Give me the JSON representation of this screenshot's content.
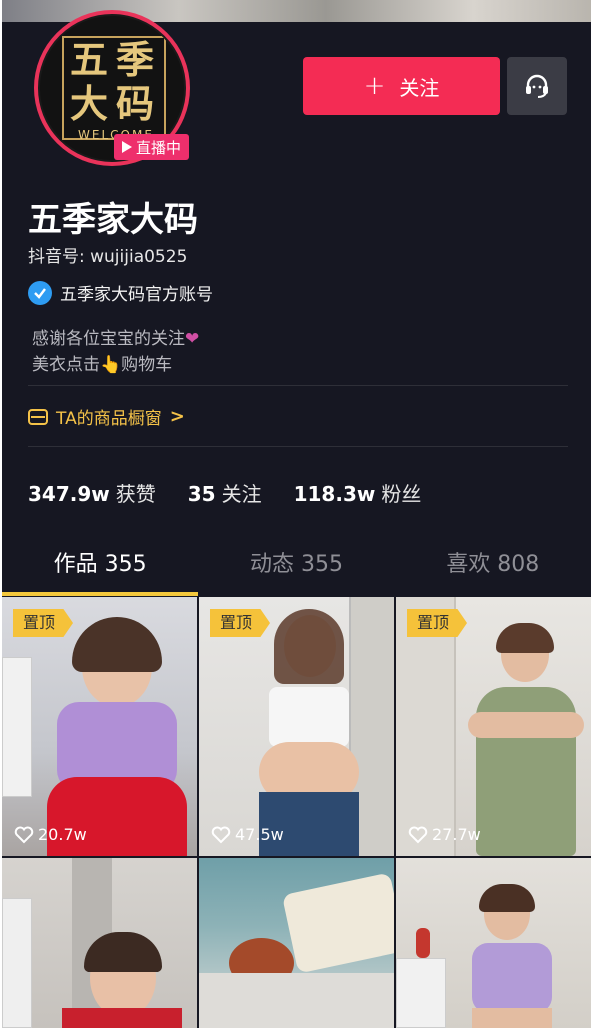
{
  "profile": {
    "avatar_logo": {
      "chars": [
        "五",
        "季",
        "大",
        "码"
      ],
      "welcome": "WELCOME"
    },
    "live_badge": "直播中",
    "follow_label": "关注",
    "follow_plus": "+",
    "name": "五季家大码",
    "douyin_id": "抖音号: wujijia0525",
    "verified_label": "五季家大码官方账号",
    "bio_line1": "感谢各位宝宝的关注",
    "bio_line2_a": "美衣点击",
    "bio_line2_b": "购物车",
    "shop_label": "TA的商品橱窗",
    "shop_chevron": ">"
  },
  "stats": [
    {
      "value": "347.9w",
      "label": "获赞"
    },
    {
      "value": "35",
      "label": "关注"
    },
    {
      "value": "118.3w",
      "label": "粉丝"
    }
  ],
  "tabs": [
    {
      "label": "作品 355"
    },
    {
      "label": "动态 355"
    },
    {
      "label": "喜欢 808"
    }
  ],
  "videos": [
    {
      "pin": "置顶",
      "likes": "20.7w"
    },
    {
      "pin": "置顶",
      "likes": "47.5w"
    },
    {
      "pin": "置顶",
      "likes": "27.7w"
    }
  ],
  "colors": {
    "accent": "#f42c54",
    "tab_indicator": "#f4c83d",
    "shop": "#f4c248",
    "verified": "#2e9cf2",
    "background": "#161722"
  }
}
